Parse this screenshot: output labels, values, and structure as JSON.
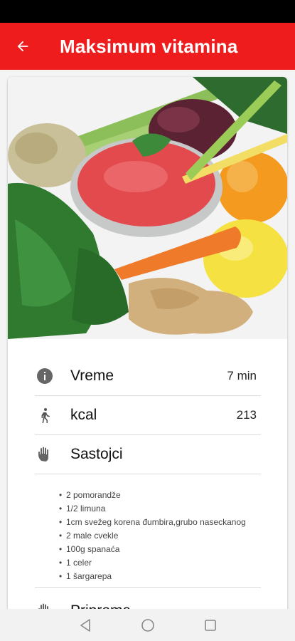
{
  "app_bar": {
    "title": "Maksimum vitamina",
    "back_icon": "arrow-left-icon",
    "color": "#ee1c1c"
  },
  "recipe": {
    "image_description": "vegetable smoothie",
    "rows": [
      {
        "icon": "info-icon",
        "label": "Vreme",
        "value": "7 min"
      },
      {
        "icon": "walking-person-icon",
        "label": "kcal",
        "value": "213"
      },
      {
        "icon": "hand-icon",
        "label": "Sastojci",
        "value": ""
      }
    ],
    "ingredients": [
      "2 pomorandže",
      "1/2 limuna",
      "1cm svežeg korena đumbira,grubo naseckanog",
      "2 male cvekle",
      "100g spanaća",
      "1 celer",
      "1 šargarepa"
    ],
    "preparation_label": "Priprema"
  },
  "nav": {
    "back_icon": "triangle-back-icon",
    "home_icon": "circle-home-icon",
    "recents_icon": "square-recents-icon"
  }
}
